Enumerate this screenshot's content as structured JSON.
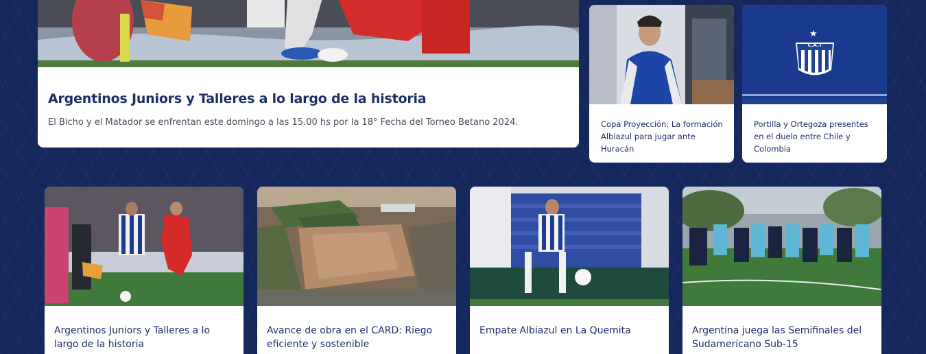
{
  "featured": {
    "title": "Argentinos Juniors y Talleres a lo largo de la historia",
    "excerpt": "El Bicho y el Matador se enfrentan este domingo a las 15.00 hs por la 18° Fecha del Torneo Betano 2024.",
    "image": "football-match-photo"
  },
  "side_cards": [
    {
      "title": "Copa Proyección: La formación Albiazul para jugar ante Huracán",
      "image": "player-portrait-photo"
    },
    {
      "title": "Portilla y Ortegoza presentes en el duelo entre Chile y Colombia",
      "image": "club-crest-graphic"
    }
  ],
  "grid_cards": [
    {
      "title": "Argentinos Juniors y Talleres a lo largo de la historia",
      "image": "match-action-photo"
    },
    {
      "title": "Avance de obra en el CARD: Riego eficiente y sostenible",
      "image": "aerial-construction-photo"
    },
    {
      "title": "Empate Albiazul en La Quemita",
      "image": "player-kick-photo"
    },
    {
      "title": "Argentina juega las Semifinales del Sudamericano Sub-15",
      "image": "team-training-photo"
    }
  ],
  "crest": {
    "stars": "★",
    "letters": "C.A.T"
  },
  "colors": {
    "background": "#15285c",
    "title": "#1c2d6b",
    "card": "#ffffff",
    "talleres_blue": "#1d3b8f",
    "pitch_green": "#3f7a3a"
  }
}
